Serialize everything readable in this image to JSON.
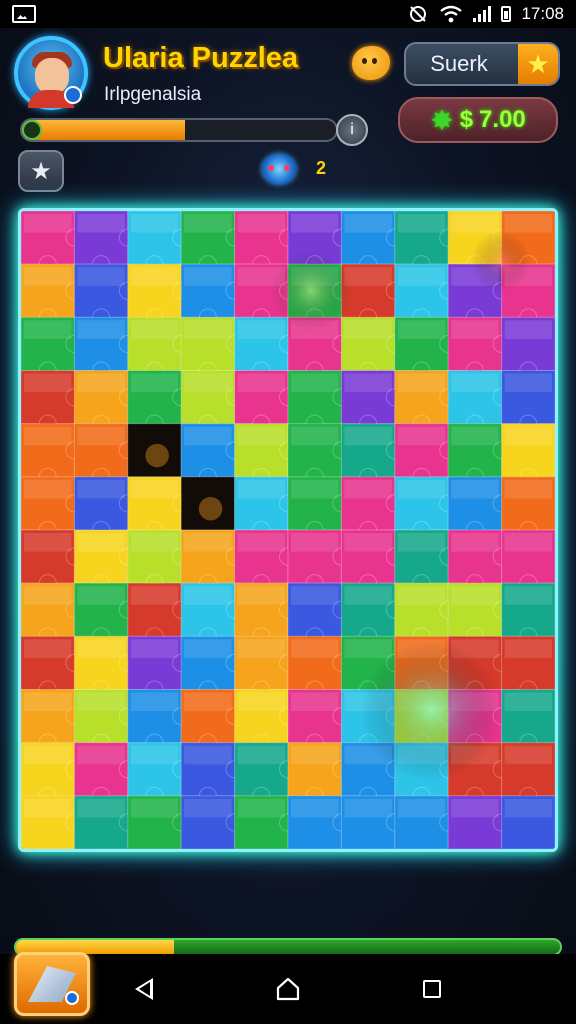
{
  "status_bar": {
    "time": "17:08",
    "icons": [
      "image-icon",
      "do-not-disturb-icon",
      "wifi-icon",
      "signal-icon",
      "battery-icon"
    ]
  },
  "header": {
    "title": "Ularia Puzzlea",
    "subtitle": "Irlpgenalsia",
    "search_label": "Suerk",
    "score": "7.00",
    "score_prefix": "$",
    "level_progress": 0.52,
    "hint_count": "2"
  },
  "board": {
    "columns": 10,
    "rows": 12,
    "palette": [
      "#1e8fe6",
      "#2cc4e8",
      "#22b34a",
      "#f5a41c",
      "#f26b1a",
      "#e8348f",
      "#7a3ad6",
      "#f7d41e",
      "#d63a2a",
      "#3a58e0",
      "#16a88a",
      "#b8e02a"
    ],
    "missing_pieces": [
      [
        2,
        4
      ],
      [
        3,
        5
      ]
    ]
  },
  "footer": {
    "progress": 0.29
  },
  "colors": {
    "title": "#ffd400",
    "board_glow": "#3affc0",
    "score": "#9cff3a"
  }
}
